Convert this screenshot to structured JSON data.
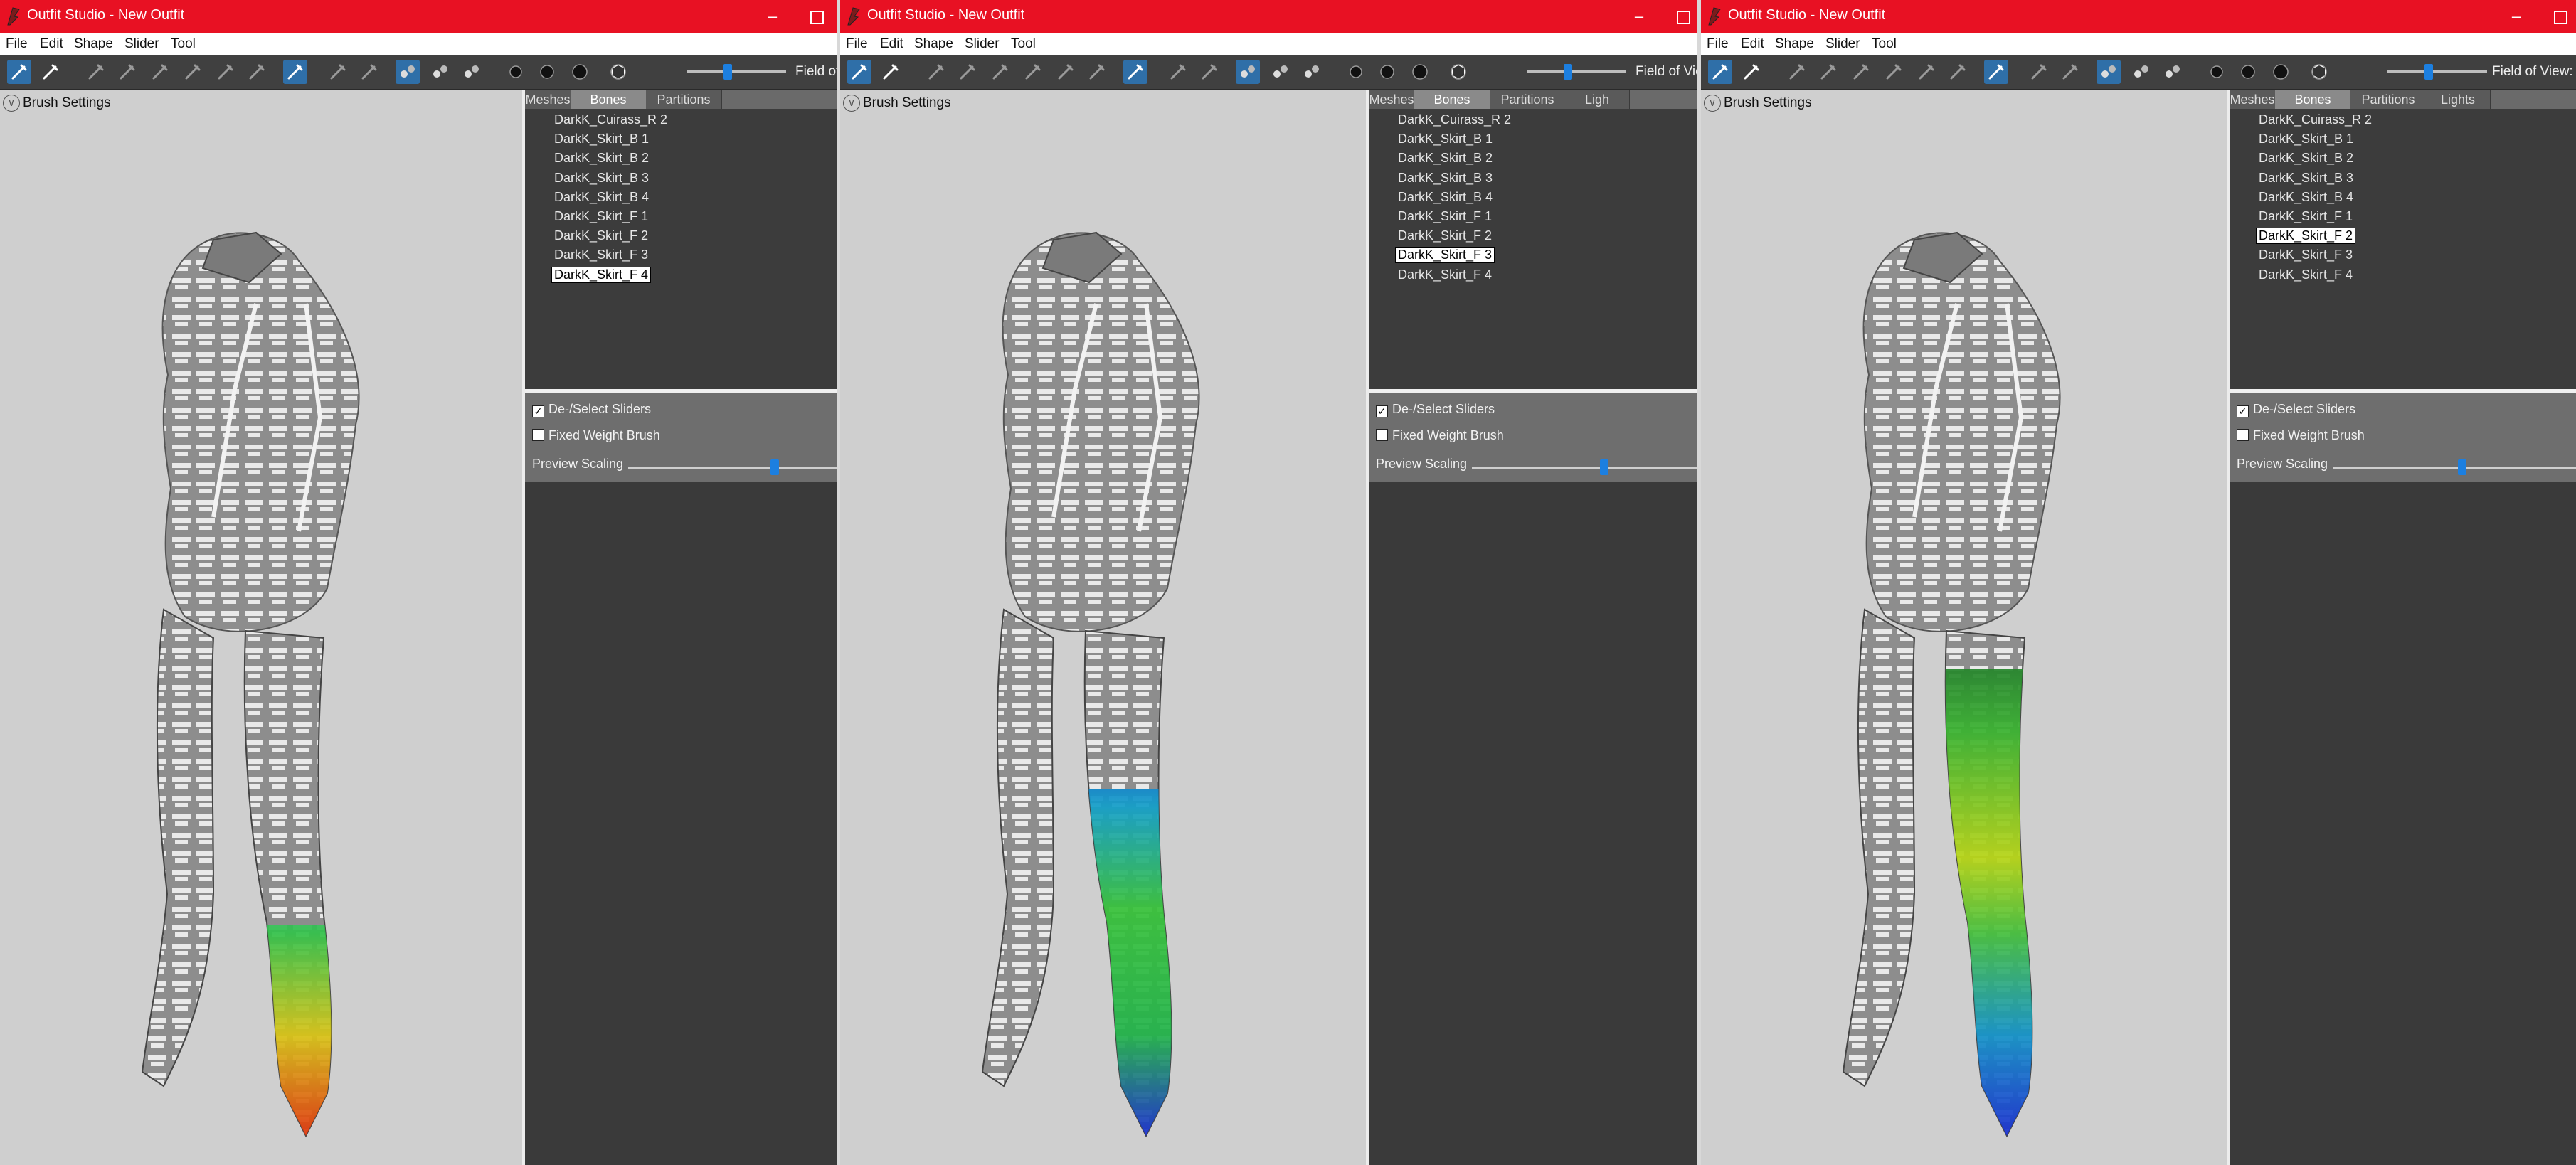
{
  "windows": [
    {
      "title": "Outfit Studio - New Outfit",
      "menu": [
        "File",
        "Edit",
        "Shape",
        "Slider",
        "Tool"
      ],
      "fov_label": "Field of",
      "brush_settings": "Brush Settings",
      "tabs": [
        "Meshes",
        "Bones",
        "Partitions"
      ],
      "active_tab": "Bones",
      "bones": [
        "DarkK_Cuirass_R 2",
        "DarkK_Skirt_B 1",
        "DarkK_Skirt_B 2",
        "DarkK_Skirt_B 3",
        "DarkK_Skirt_B 4",
        "DarkK_Skirt_F 1",
        "DarkK_Skirt_F 2",
        "DarkK_Skirt_F 3",
        "DarkK_Skirt_F 4"
      ],
      "selected_bone": "DarkK_Skirt_F 4",
      "deselect_sliders": "De-/Select Sliders",
      "fixed_weight_brush": "Fixed Weight Brush",
      "preview_scaling": "Preview Scaling"
    },
    {
      "title": "Outfit Studio - New Outfit",
      "menu": [
        "File",
        "Edit",
        "Shape",
        "Slider",
        "Tool"
      ],
      "fov_label": "Field of View",
      "brush_settings": "Brush Settings",
      "tabs": [
        "Meshes",
        "Bones",
        "Partitions",
        "Ligh"
      ],
      "active_tab": "Bones",
      "bones": [
        "DarkK_Cuirass_R 2",
        "DarkK_Skirt_B 1",
        "DarkK_Skirt_B 2",
        "DarkK_Skirt_B 3",
        "DarkK_Skirt_B 4",
        "DarkK_Skirt_F 1",
        "DarkK_Skirt_F 2",
        "DarkK_Skirt_F 3",
        "DarkK_Skirt_F 4"
      ],
      "selected_bone": "DarkK_Skirt_F 3",
      "deselect_sliders": "De-/Select Sliders",
      "fixed_weight_brush": "Fixed Weight Brush",
      "preview_scaling": "Preview Scaling"
    },
    {
      "title": "Outfit Studio - New Outfit",
      "menu": [
        "File",
        "Edit",
        "Shape",
        "Slider",
        "Tool"
      ],
      "fov_label": "Field of View:",
      "brush_settings": "Brush Settings",
      "tabs": [
        "Meshes",
        "Bones",
        "Partitions",
        "Lights"
      ],
      "active_tab": "Bones",
      "bones": [
        "DarkK_Cuirass_R 2",
        "DarkK_Skirt_B 1",
        "DarkK_Skirt_B 2",
        "DarkK_Skirt_B 3",
        "DarkK_Skirt_B 4",
        "DarkK_Skirt_F 1",
        "DarkK_Skirt_F 2",
        "DarkK_Skirt_F 3",
        "DarkK_Skirt_F 4"
      ],
      "selected_bone": "DarkK_Skirt_F 2",
      "deselect_sliders": "De-/Select Sliders",
      "fixed_weight_brush": "Fixed Weight Brush",
      "preview_scaling": "Preview Scaling"
    }
  ],
  "colors": {
    "titlebar": "#e81123",
    "toolbar": "#404040",
    "viewport": "#cfcfcf",
    "panel": "#3a3a3a",
    "accent": "#1c7fe0"
  },
  "icons": [
    "app-icon",
    "minimize-icon",
    "maximize-icon",
    "brush-settings-chevron-icon"
  ]
}
